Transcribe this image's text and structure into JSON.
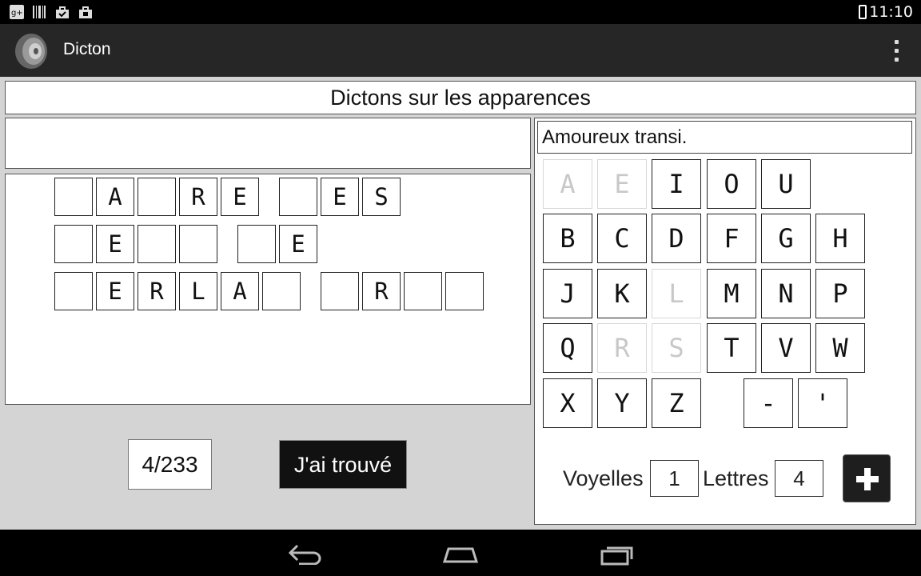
{
  "status_bar": {
    "time": "11:10",
    "icons": [
      "google-plus-icon",
      "barcode-icon",
      "bag-check-icon",
      "bag-icon"
    ]
  },
  "action_bar": {
    "title": "Dicton",
    "logo": "speaker-logo-icon"
  },
  "category": "Dictons sur les apparences",
  "answer_text": "",
  "puzzle_rows": [
    [
      "",
      "A",
      "",
      "R",
      "E",
      " ",
      "",
      "E",
      "S"
    ],
    [
      "",
      "E",
      "",
      "",
      " ",
      "",
      "E"
    ],
    [
      "",
      "E",
      "R",
      "L",
      "A",
      "",
      " ",
      "",
      "R",
      "",
      ""
    ]
  ],
  "counter": "4/233",
  "found_button": "J'ai trouvé",
  "hint": "Amoureux transi.",
  "keyboard": {
    "vowels": [
      {
        "k": "A",
        "used": true
      },
      {
        "k": "E",
        "used": true
      },
      {
        "k": "I",
        "used": false
      },
      {
        "k": "O",
        "used": false
      },
      {
        "k": "U",
        "used": false
      }
    ],
    "row1": [
      {
        "k": "B",
        "used": false
      },
      {
        "k": "C",
        "used": false
      },
      {
        "k": "D",
        "used": false
      },
      {
        "k": "F",
        "used": false
      },
      {
        "k": "G",
        "used": false
      },
      {
        "k": "H",
        "used": false
      }
    ],
    "row2": [
      {
        "k": "J",
        "used": false
      },
      {
        "k": "K",
        "used": false
      },
      {
        "k": "L",
        "used": true
      },
      {
        "k": "M",
        "used": false
      },
      {
        "k": "N",
        "used": false
      },
      {
        "k": "P",
        "used": false
      }
    ],
    "row3": [
      {
        "k": "Q",
        "used": false
      },
      {
        "k": "R",
        "used": true
      },
      {
        "k": "S",
        "used": true
      },
      {
        "k": "T",
        "used": false
      },
      {
        "k": "V",
        "used": false
      },
      {
        "k": "W",
        "used": false
      }
    ],
    "row4": [
      {
        "k": "X",
        "used": false
      },
      {
        "k": "Y",
        "used": false
      },
      {
        "k": "Z",
        "used": false
      }
    ],
    "punct": [
      {
        "k": "-",
        "used": false
      },
      {
        "k": "'",
        "used": false
      }
    ]
  },
  "stats": {
    "vowels_label": "Voyelles",
    "vowels_value": "1",
    "letters_label": "Lettres",
    "letters_value": "4"
  },
  "icons": {
    "plus": "plus-icon",
    "overflow": "overflow-menu-icon",
    "back": "back-icon",
    "home": "home-icon",
    "recents": "recents-icon"
  }
}
